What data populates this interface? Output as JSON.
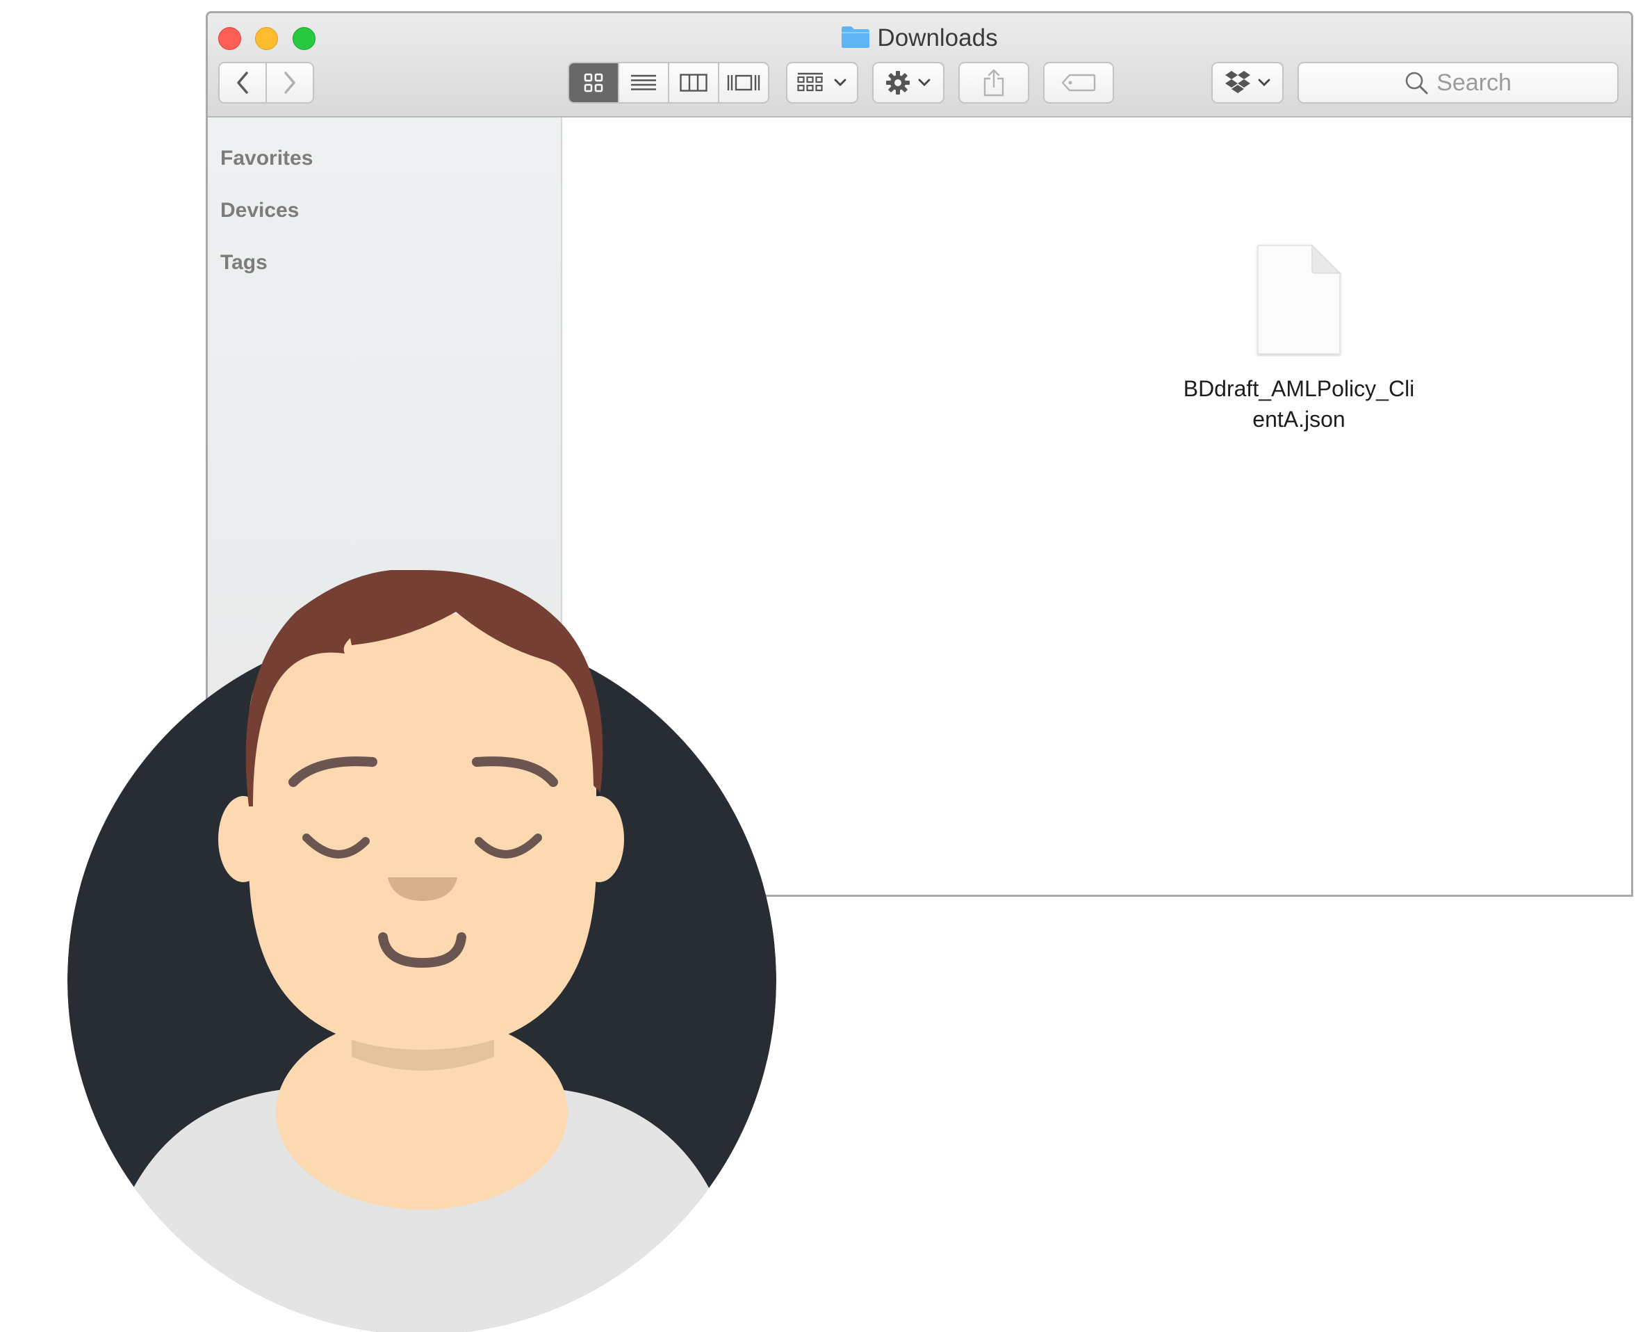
{
  "window": {
    "title": "Downloads",
    "title_icon": "folder-icon"
  },
  "toolbar": {
    "back_icon": "chevron-left-icon",
    "forward_icon": "chevron-right-icon",
    "view_modes": [
      "icon-view-icon",
      "list-view-icon",
      "column-view-icon",
      "cover-flow-icon"
    ],
    "active_view": "icon-view-icon",
    "group_icon": "arrange-icon",
    "action_icon": "gear-icon",
    "share_icon": "share-icon",
    "tag_icon": "tag-icon",
    "dropbox_icon": "dropbox-icon",
    "search_placeholder": "Search"
  },
  "sidebar": {
    "sections": [
      "Favorites",
      "Devices",
      "Tags"
    ]
  },
  "content": {
    "files": [
      {
        "name": "BDdraft_AMLPolicy_ClientA.json",
        "icon": "document-icon"
      }
    ]
  },
  "colors": {
    "traffic_close": "#fd5f57",
    "traffic_min": "#fdbc2e",
    "traffic_max": "#28c840",
    "folder": "#5fb4f3",
    "avatar_bg": "#272d33",
    "skin": "#fcd9b1",
    "hair": "#763f33",
    "shirt": "#e4e4e4"
  }
}
